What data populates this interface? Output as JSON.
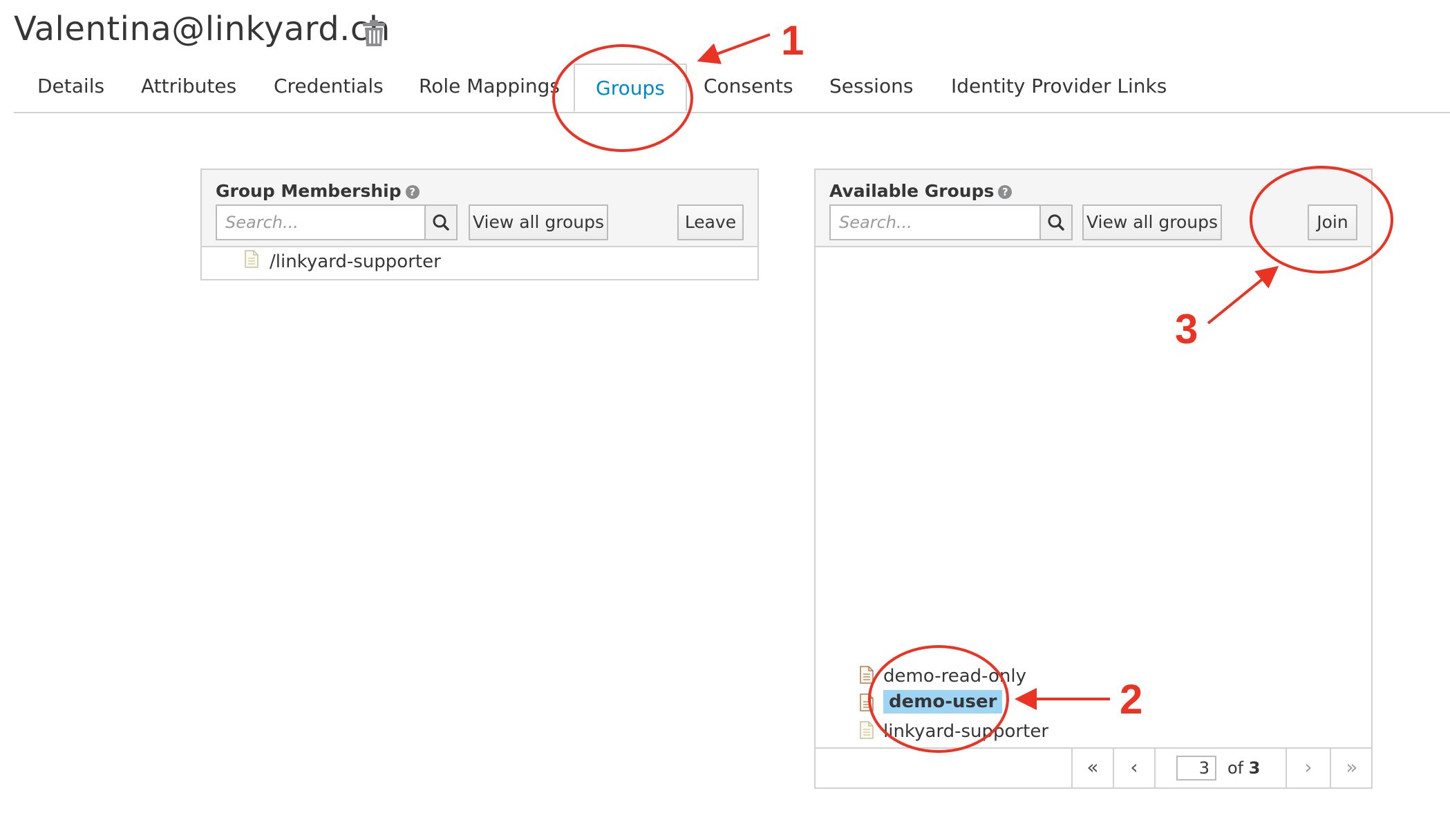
{
  "header": {
    "username": "Valentina@linkyard.ch",
    "delete_icon": "trash-icon"
  },
  "tabs": [
    {
      "label": "Details"
    },
    {
      "label": "Attributes"
    },
    {
      "label": "Credentials"
    },
    {
      "label": "Role Mappings"
    },
    {
      "label": "Groups",
      "active": true
    },
    {
      "label": "Consents"
    },
    {
      "label": "Sessions"
    },
    {
      "label": "Identity Provider Links"
    }
  ],
  "group_membership": {
    "title": "Group Membership",
    "help_icon": "question-circle-icon",
    "search_placeholder": "Search...",
    "view_all_label": "View all groups",
    "leave_label": "Leave",
    "items": [
      {
        "label": "/linkyard-supporter"
      }
    ]
  },
  "available_groups": {
    "title": "Available Groups",
    "help_icon": "question-circle-icon",
    "search_placeholder": "Search...",
    "view_all_label": "View all groups",
    "join_label": "Join",
    "items": [
      {
        "label": "demo-read-only"
      },
      {
        "label": "demo-user",
        "selected": true
      },
      {
        "label": "linkyard-supporter"
      }
    ],
    "pager": {
      "current_page": "3",
      "of_label": "of",
      "total_pages": "3",
      "first_icon": "double-chevron-left-icon",
      "prev_icon": "chevron-left-icon",
      "next_icon": "chevron-right-icon",
      "last_icon": "double-chevron-right-icon"
    }
  },
  "annotations": {
    "step1": "1",
    "step2": "2",
    "step3": "3",
    "color": "#ea3323"
  },
  "colors": {
    "active_tab": "#0088ce",
    "selection": "#9ed5f5"
  }
}
